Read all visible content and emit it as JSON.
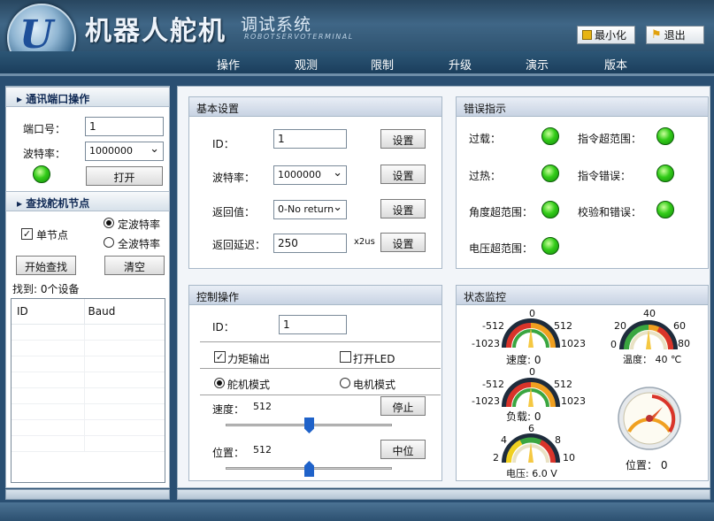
{
  "header": {
    "title": "机器人舵机",
    "subtitle": "调试系统",
    "en": "ROBOTSERVOTERMINAL",
    "minimize": "最小化",
    "exit": "退出"
  },
  "menu": [
    "操作",
    "观测",
    "限制",
    "升级",
    "演示",
    "版本"
  ],
  "comm": {
    "header": "通讯端口操作",
    "port_label": "端口号：",
    "port_value": "1",
    "baud_label": "波特率：",
    "baud_value": "1000000",
    "open": "打开"
  },
  "find": {
    "header": "查找舵机节点",
    "single": "单节点",
    "fixed_baud": "定波特率",
    "all_baud": "全波特率",
    "start": "开始查找",
    "clear": "清空",
    "found": "找到: 0个设备",
    "col_id": "ID",
    "col_baud": "Baud"
  },
  "basic": {
    "header": "基本设置",
    "id_label": "ID：",
    "id_value": "1",
    "baud_label": "波特率：",
    "baud_value": "1000000",
    "ret_label": "返回值：",
    "ret_value": "0-No return",
    "delay_label": "返回延迟：",
    "delay_value": "250",
    "delay_unit": "x2us",
    "set": "设置"
  },
  "error": {
    "header": "错误指示",
    "items": [
      "过载：",
      "指令超范围：",
      "过热：",
      "指令错误：",
      "角度超范围：",
      "校验和错误：",
      "电压超范围："
    ]
  },
  "control": {
    "header": "控制操作",
    "id_label": "ID：",
    "id_value": "1",
    "torque": "力矩输出",
    "led": "打开LED",
    "servo_mode": "舵机模式",
    "motor_mode": "电机模式",
    "speed_label": "速度：",
    "speed_value": "512",
    "stop": "停止",
    "pos_label": "位置：",
    "pos_value": "512",
    "center": "中位"
  },
  "monitor": {
    "header": "状态监控",
    "speed": {
      "label": "速度: 0",
      "ticks": [
        "0",
        "512",
        "1023",
        "-1023",
        "-512"
      ]
    },
    "temp": {
      "label": "温度： 40 ℃",
      "ticks": [
        "0",
        "20",
        "40",
        "60",
        "80"
      ]
    },
    "load": {
      "label": "负载: 0",
      "ticks": [
        "0",
        "512",
        "1023",
        "-1023",
        "-512"
      ]
    },
    "volt": {
      "label": "电压: 6.0 V",
      "ticks": [
        "2",
        "4",
        "6",
        "8",
        "10"
      ]
    },
    "position": {
      "label": "位置： 0"
    }
  }
}
